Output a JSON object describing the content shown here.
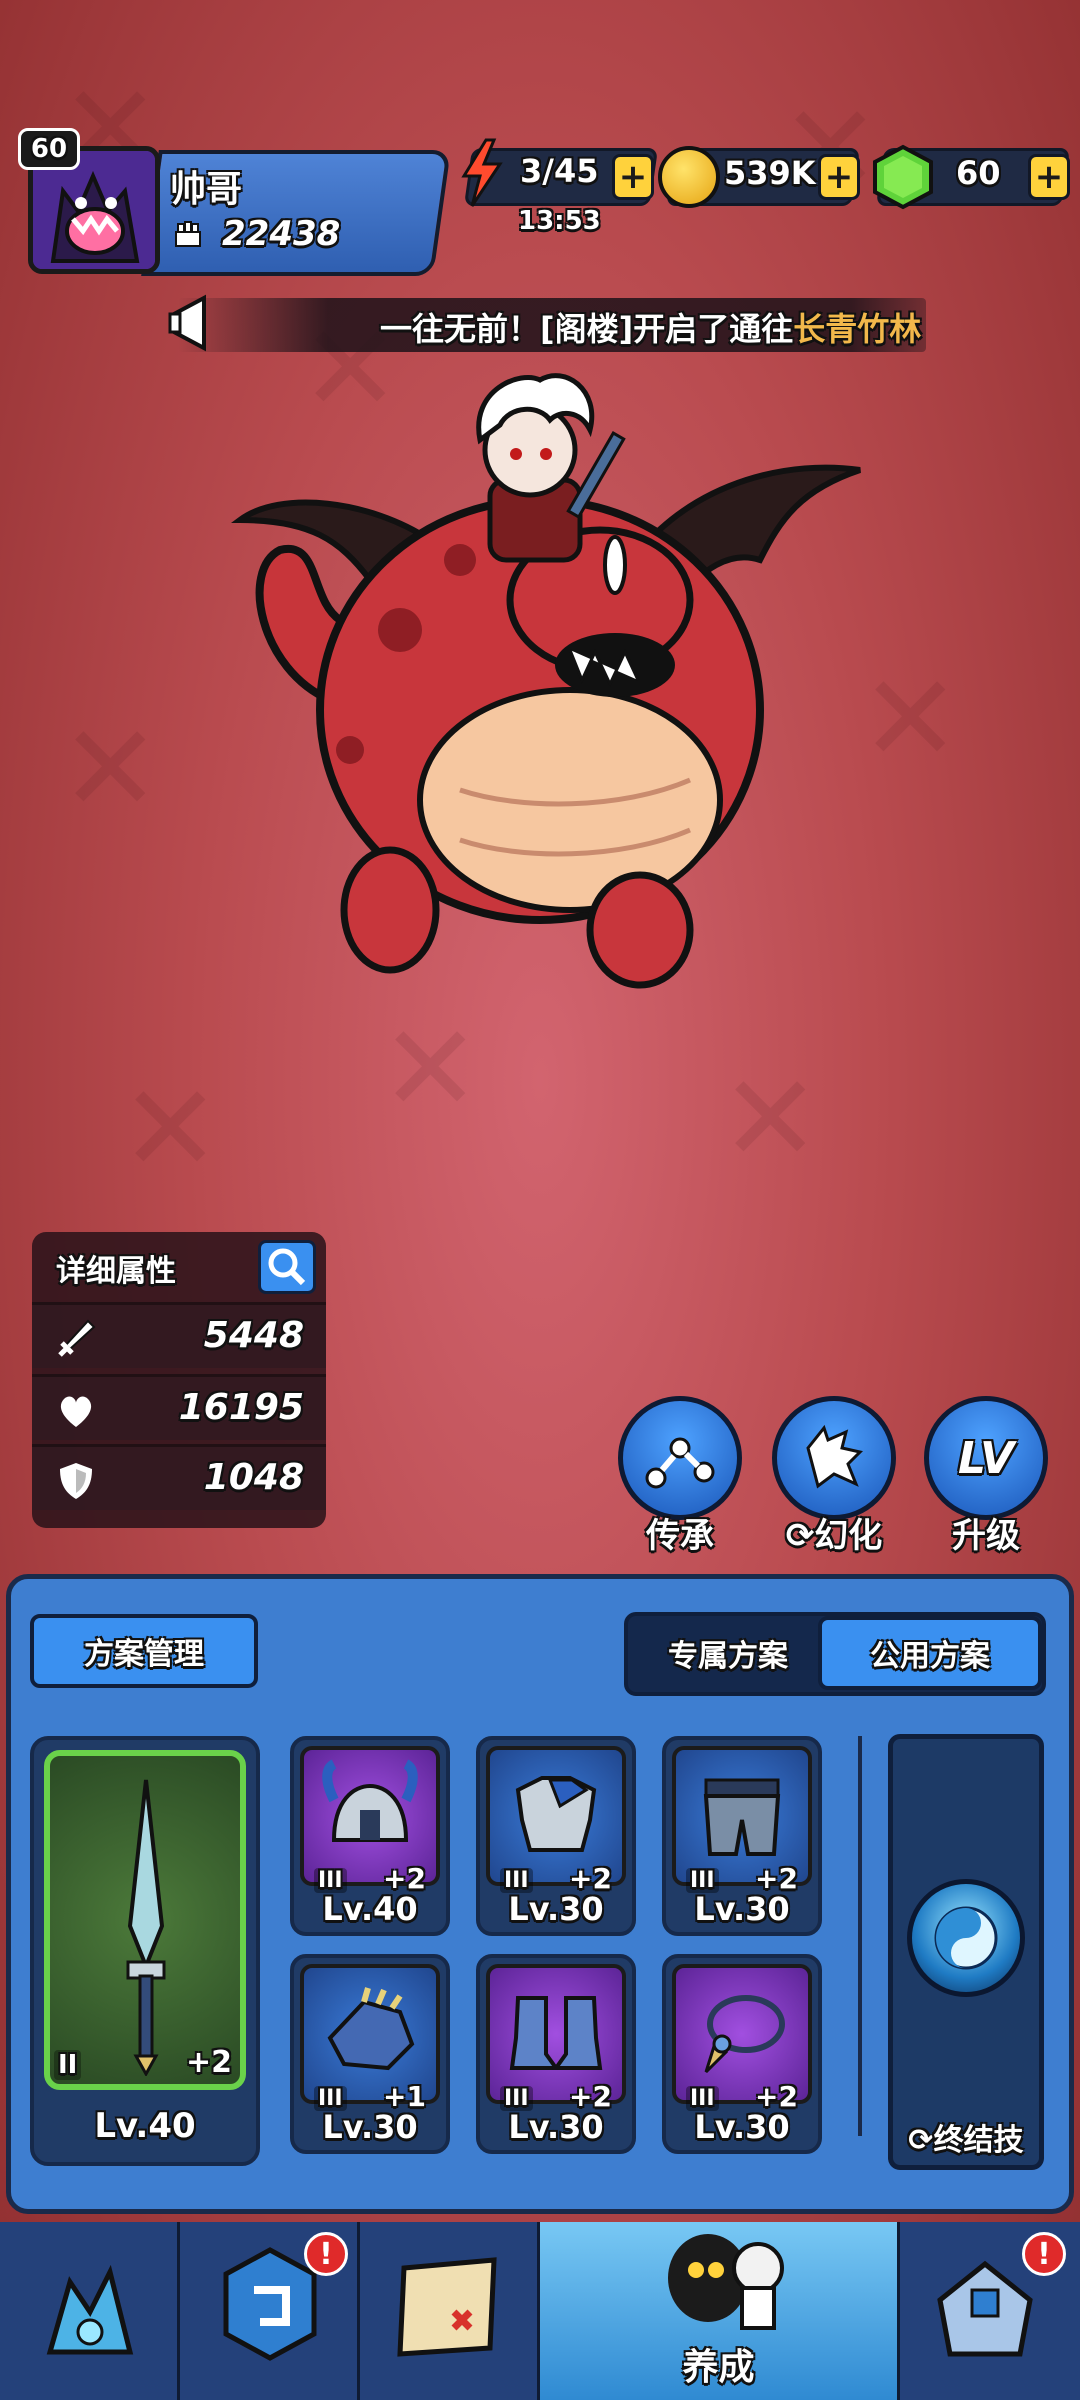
{
  "player": {
    "level": "60",
    "name": "帅哥",
    "power": "22438"
  },
  "resources": {
    "energy": "3/45",
    "energy_timer": "13:53",
    "gold": "539K",
    "gems": "60",
    "plus": "+"
  },
  "announcement": {
    "text_prefix": "一往无前！[阁楼]开启了通往",
    "text_highlight": "长青竹林",
    "highlight_color": "#f2b84b"
  },
  "stats": {
    "title": "详细属性",
    "attack": "5448",
    "health": "16195",
    "defense": "1048"
  },
  "actions": {
    "inherit": "传承",
    "illusion": "幻化",
    "upgrade": "升级",
    "lv_icon": "LV"
  },
  "panel": {
    "plan_manage": "方案管理",
    "tab_exclusive": "专属方案",
    "tab_public": "公用方案",
    "finisher": "终结技",
    "weapon": {
      "tier": "II",
      "plus": "+2",
      "level": "Lv.40"
    },
    "gear": [
      {
        "tier": "III",
        "plus": "+2",
        "level": "Lv.40",
        "rarity": "purple",
        "icon": "helmet-icon"
      },
      {
        "tier": "III",
        "plus": "+2",
        "level": "Lv.30",
        "rarity": "blue",
        "icon": "armor-icon"
      },
      {
        "tier": "III",
        "plus": "+2",
        "level": "Lv.30",
        "rarity": "blue",
        "icon": "pants-icon"
      },
      {
        "tier": "III",
        "plus": "+1",
        "level": "Lv.30",
        "rarity": "blue",
        "icon": "gauntlet-icon"
      },
      {
        "tier": "III",
        "plus": "+2",
        "level": "Lv.30",
        "rarity": "purple",
        "icon": "boots-icon"
      },
      {
        "tier": "III",
        "plus": "+2",
        "level": "Lv.30",
        "rarity": "purple",
        "icon": "necklace-icon"
      }
    ]
  },
  "nav": {
    "active_label": "养成",
    "badge": "!"
  }
}
